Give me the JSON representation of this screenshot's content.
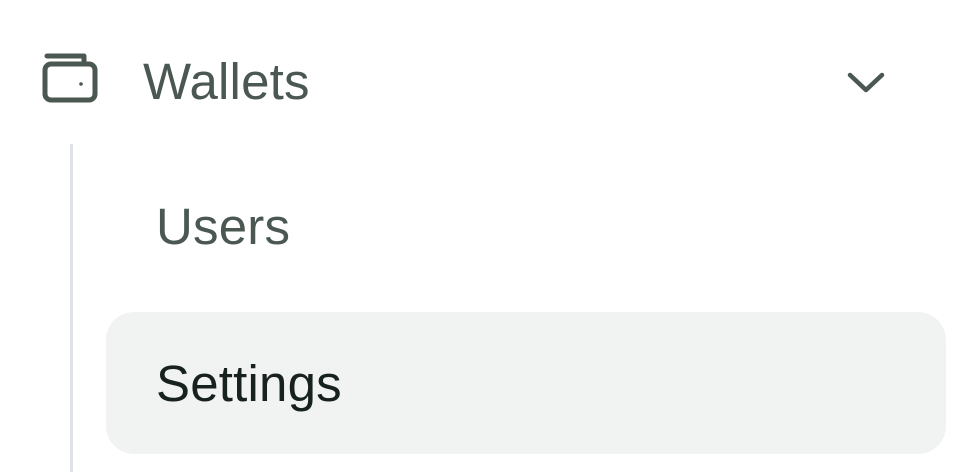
{
  "sidebar": {
    "group": {
      "label": "Wallets",
      "icon": "wallet-icon",
      "toggle_icon": "chevron-down-icon",
      "expanded": true
    },
    "items": [
      {
        "label": "Users",
        "active": false
      },
      {
        "label": "Settings",
        "active": true
      }
    ]
  },
  "colors": {
    "text_muted": "#4b5852",
    "text_active": "#17211e",
    "active_bg": "#f1f2f2",
    "tree_line": "#dfe3e7"
  }
}
